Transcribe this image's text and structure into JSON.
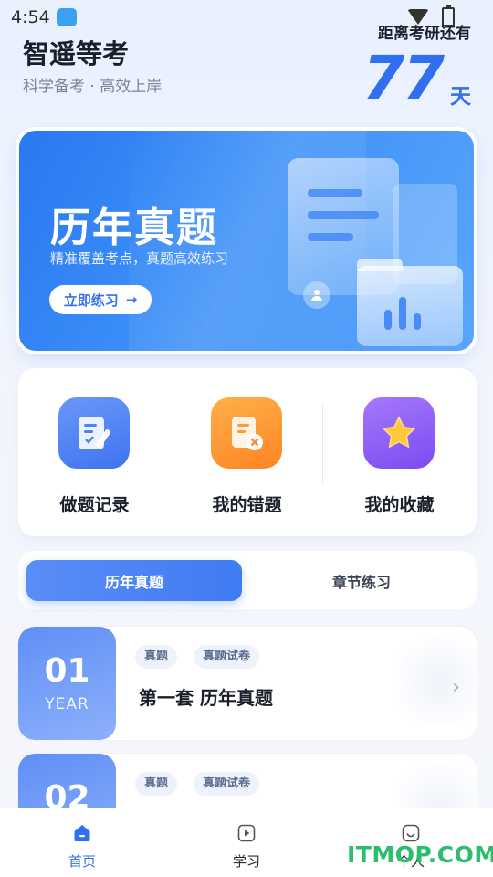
{
  "status_bar": {
    "time": "4:54"
  },
  "header": {
    "title": "智遥等考",
    "subtitle": "科学备考 · 高效上岸",
    "countdown_label": "距离考研还有",
    "countdown_days": "77",
    "countdown_unit": "天"
  },
  "banner": {
    "title": "历年真题",
    "subtitle": "精准覆盖考点，真题高效练习",
    "button_label": "立即练习",
    "button_arrow": "→"
  },
  "quick_actions": [
    {
      "label": "做题记录",
      "icon": "notebook-pen-icon",
      "color": "#4f83f5"
    },
    {
      "label": "我的错题",
      "icon": "document-error-icon",
      "color": "#ff8c2a"
    },
    {
      "label": "我的收藏",
      "icon": "star-icon",
      "color": "#8a5cf5"
    }
  ],
  "tabs": {
    "active": "历年真题",
    "inactive": "章节练习"
  },
  "papers": [
    {
      "number": "01",
      "year_label": "YEAR",
      "tags": [
        "真题",
        "真题试卷"
      ],
      "title": "第一套 历年真题",
      "chevron": "›"
    },
    {
      "number": "02",
      "tags": [
        "真题",
        "真题试卷"
      ]
    }
  ],
  "bottom_nav": [
    {
      "label": "首页",
      "icon": "home-icon",
      "active": true
    },
    {
      "label": "学习",
      "icon": "play-square-icon",
      "active": false
    },
    {
      "label": "个人",
      "icon": "smile-face-icon",
      "active": false
    }
  ],
  "watermark": "ITMOP.COM",
  "colors": {
    "primary": "#2f6ff0",
    "watermark": "#2cbe6e"
  }
}
